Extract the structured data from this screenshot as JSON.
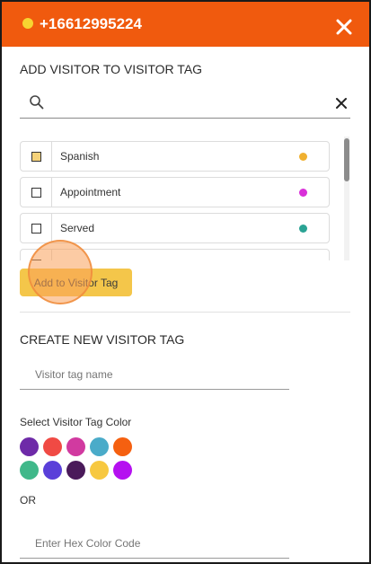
{
  "header": {
    "phone_number": "+16612995224",
    "status_dot_color": "#f7d531",
    "background_color": "#f05a0e",
    "close_icon": "close-icon"
  },
  "add_section": {
    "title": "ADD VISITOR TO VISITOR TAG",
    "search": {
      "value": "",
      "placeholder": "",
      "search_icon": "search-icon",
      "clear_icon": "clear-icon"
    },
    "tags": [
      {
        "label": "Spanish",
        "checked": true,
        "color": "#f0b030"
      },
      {
        "label": "Appointment",
        "checked": false,
        "color": "#d930d9"
      },
      {
        "label": "Served",
        "checked": false,
        "color": "#2aa394"
      },
      {
        "label": "",
        "checked": false,
        "color": ""
      }
    ],
    "add_button_label": "Add to Visitor Tag"
  },
  "create_section": {
    "title": "CREATE NEW VISITOR TAG",
    "tag_name": {
      "value": "",
      "placeholder": "Visitor tag name"
    },
    "color_label": "Select Visitor Tag Color",
    "color_swatches": [
      [
        "#6e2aa8",
        "#f04a44",
        "#d13aa0",
        "#4aabc9",
        "#f56010"
      ],
      [
        "#40b88a",
        "#5a3fd9",
        "#4a1a5a",
        "#f7c840",
        "#b510f0"
      ]
    ],
    "or_label": "OR",
    "hex_input": {
      "value": "",
      "placeholder": "Enter Hex Color Code"
    }
  }
}
